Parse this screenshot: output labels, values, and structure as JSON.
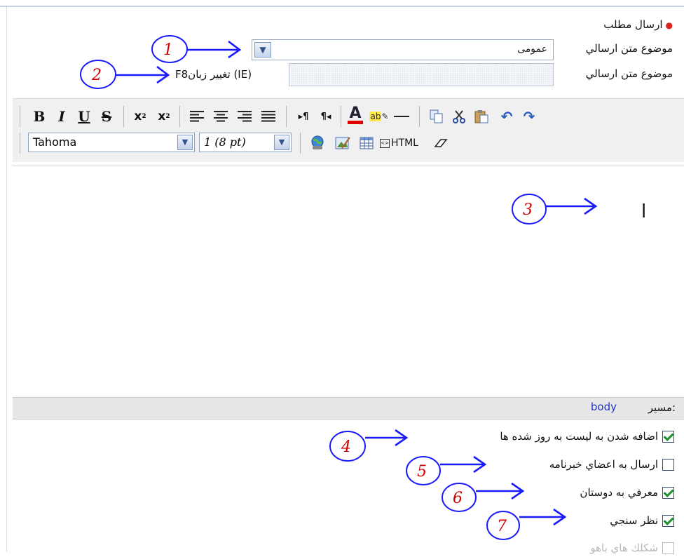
{
  "header": {
    "title": "ارسال مطلب"
  },
  "form": {
    "subject_label": "موضوع متن ارسالي",
    "category_value": "عمومی",
    "title_label": "موضوع متن ارسالي",
    "title_value": "",
    "language_hint": "F8تغيير زبان (IE)"
  },
  "toolbar": {
    "row1": [
      "bold-icon",
      "italic-icon",
      "underline-icon",
      "strikethrough-icon",
      "subscript-icon",
      "superscript-icon",
      "align-left-icon",
      "align-center-icon",
      "align-right-icon",
      "align-justify-icon",
      "ltr-icon",
      "rtl-icon",
      "text-color-icon",
      "highlight-icon",
      "horizontal-rule-icon",
      "copy-icon",
      "cut-icon",
      "paste-icon",
      "undo-icon",
      "redo-icon"
    ],
    "font_name": "Tahoma",
    "font_size": "1 (8 pt)",
    "html_label": "HTML",
    "row2_icons": [
      "insert-link-icon",
      "insert-image-icon",
      "insert-table-icon",
      "html-mode-icon",
      "eraser-icon"
    ],
    "text_color": "#e00000"
  },
  "editor": {
    "content": "ا"
  },
  "path_bar": {
    "label": "مسير:",
    "value": "body"
  },
  "options": [
    {
      "label": "اضافه شدن به ليست به روز شده ها",
      "checked": true
    },
    {
      "label": "ارسال به اعضاي خبرنامه",
      "checked": false
    },
    {
      "label": "معرفي به دوستان",
      "checked": true
    },
    {
      "label": "نظر سنجي",
      "checked": true
    },
    {
      "label": "شكلك هاي باهو",
      "checked": false
    }
  ],
  "annotations": [
    "1",
    "2",
    "3",
    "4",
    "5",
    "6",
    "7"
  ],
  "colors": {
    "annotation_circle": "#1a1aff",
    "annotation_number": "#d00000",
    "check": "#1b8f2b"
  }
}
